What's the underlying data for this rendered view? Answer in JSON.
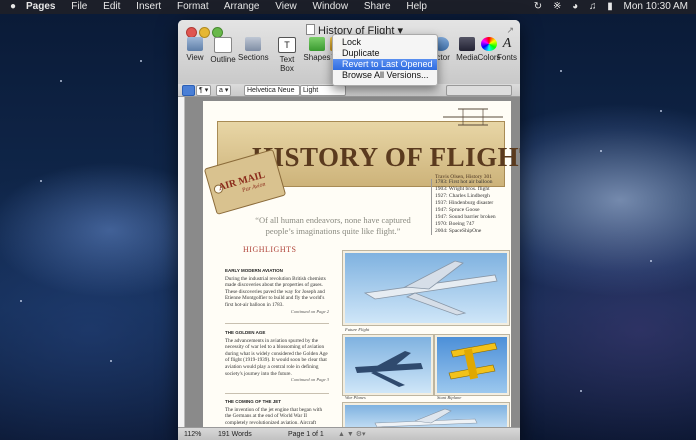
{
  "menubar": {
    "apple": "",
    "items": [
      "Pages",
      "File",
      "Edit",
      "Insert",
      "Format",
      "Arrange",
      "View",
      "Window",
      "Share",
      "Help"
    ],
    "clock": "Mon 10:30 AM"
  },
  "window": {
    "title": "History of Flight",
    "title_arrow": "▾"
  },
  "toolbar": {
    "buttons": [
      {
        "label": "View",
        "icon": "view-icon"
      },
      {
        "label": "Outline",
        "icon": "outline-icon"
      },
      {
        "label": "Sections",
        "icon": "sections-icon"
      },
      {
        "label": "Text Box",
        "icon": "textbox-icon"
      },
      {
        "label": "Shapes",
        "icon": "shapes-icon"
      },
      {
        "label": "Tab",
        "icon": "table-icon"
      },
      {
        "label": "ector",
        "icon": "inspector-icon"
      },
      {
        "label": "Media",
        "icon": "media-icon"
      },
      {
        "label": "Colors",
        "icon": "colors-icon"
      },
      {
        "label": "Fonts",
        "icon": "fonts-icon"
      }
    ]
  },
  "formatbar": {
    "style_label": "a",
    "font": "Helvetica Neue",
    "weight": "Light"
  },
  "version_menu": {
    "items": [
      "Lock",
      "Duplicate",
      "Revert to Last Opened",
      "Browse All Versions..."
    ],
    "selected_index": 2
  },
  "document": {
    "banner_title": "HISTORY OF FLIGHT",
    "author": "Travis Olsen, History 301",
    "tag_main": "AIR MAIL",
    "tag_sub": "Par Avion",
    "quote": "“Of all human endeavors, none have captured people’s imaginations quite like flight.”",
    "timeline": [
      "1783: First hot air balloon",
      "1903: Wright bros. flight",
      "1927: Charles Lindbergh",
      "1937: Hindenburg disaster",
      "1947: Spruce Goose",
      "1947: Sound barrier broken",
      "1970: Boeing 747",
      "2004: SpaceShipOne"
    ],
    "highlights": "HIGHLIGHTS",
    "sections": [
      {
        "heading": "EARLY MODERN AVIATION",
        "body": "During the industrial revolution British chemists made discoveries about the properties of gases. These discoveries paved the way for Joseph and Etienne Montgolfier to build and fly the world's first hot-air balloon in 1783.",
        "continued": "Continued on Page 2"
      },
      {
        "heading": "THE GOLDEN AGE",
        "body": "The advancements in aviation spurred by the necessity of war led to a blossoming of aviation during what is widely considered the Golden Age of flight (1919-1939). It would soon be clear that aviation would play a central role in defining society's journey into the future.",
        "continued": "Continued on Page 3"
      },
      {
        "heading": "THE COMING OF THE JET",
        "body": "The invention of the jet engine that began with the Germans at the end of World War II completely revolutionized aviation. Aircraft",
        "continued": ""
      }
    ],
    "captions": [
      "Future Flight",
      "War Planes",
      "Stunt Biplane"
    ]
  },
  "statusbar": {
    "zoom": "112%",
    "words": "191 Words",
    "page": "Page 1 of 1"
  },
  "colors": {
    "accent": "#2f6ce0",
    "title_brown": "#5a3a1e",
    "highlight_red": "#b0443a"
  }
}
